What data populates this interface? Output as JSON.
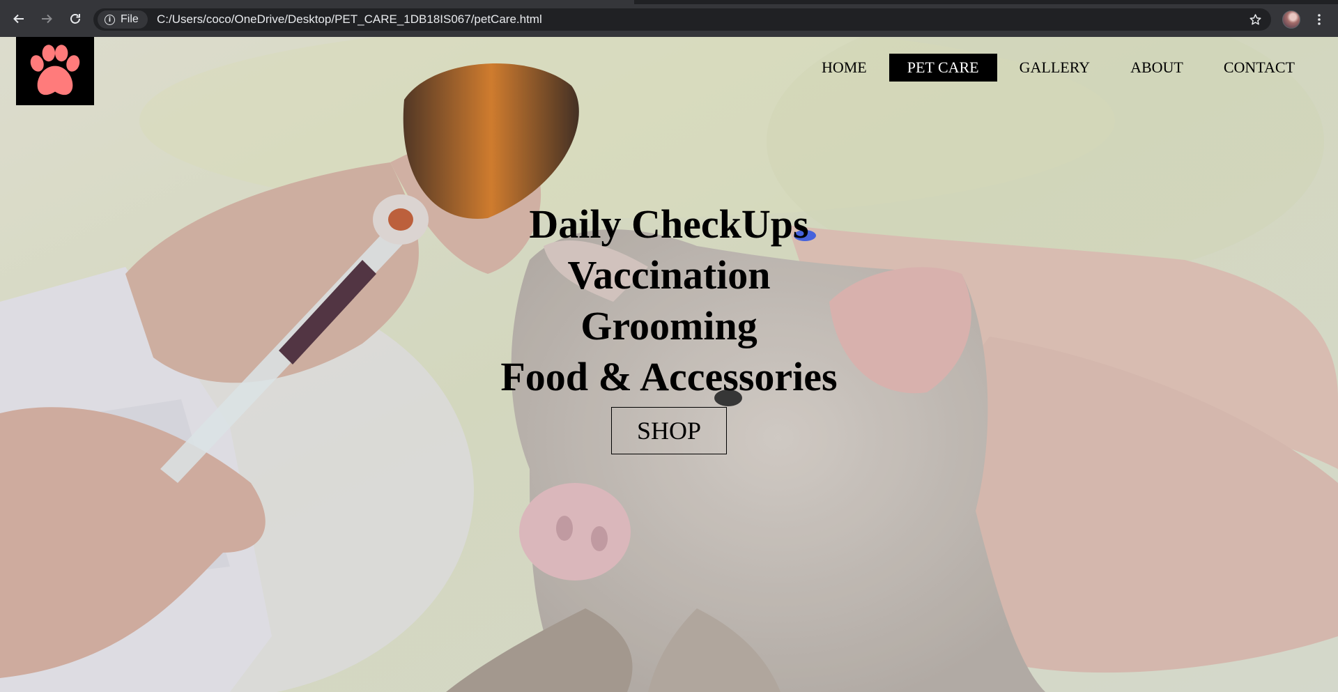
{
  "browser": {
    "back_icon": "arrow-left-icon",
    "forward_icon": "arrow-right-icon",
    "reload_icon": "reload-icon",
    "site_chip_icon": "info-icon",
    "site_chip_label": "File",
    "url": "C:/Users/coco/OneDrive/Desktop/PET_CARE_1DB18IS067/petCare.html",
    "bookmark_icon": "star-icon",
    "menu_icon": "kebab-menu-icon"
  },
  "page": {
    "logo_icon": "paw-icon",
    "logo_color": "#ff7b7b",
    "nav": [
      {
        "label": "HOME",
        "active": false
      },
      {
        "label": "PET CARE",
        "active": true
      },
      {
        "label": "GALLERY",
        "active": false
      },
      {
        "label": "ABOUT",
        "active": false
      },
      {
        "label": "CONTACT",
        "active": false
      }
    ],
    "hero": {
      "lines": [
        "Daily CheckUps",
        "Vaccination",
        "Grooming",
        "Food & Accessories"
      ],
      "button_label": "SHOP"
    }
  }
}
